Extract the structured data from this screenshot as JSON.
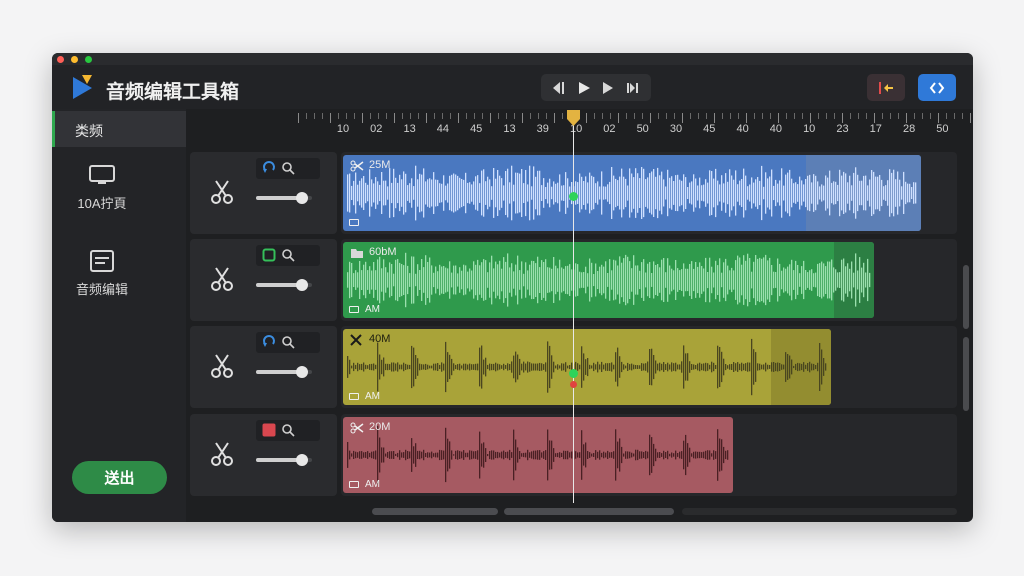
{
  "app": {
    "title": "音频编辑工具箱"
  },
  "header": {
    "transport": [
      {
        "name": "skip-back-icon"
      },
      {
        "name": "play-icon"
      },
      {
        "name": "step-forward-icon"
      },
      {
        "name": "skip-forward-icon"
      }
    ],
    "right_buttons": [
      {
        "name": "marker-icon",
        "color": "#3a3034"
      },
      {
        "name": "export-icon",
        "color": "#2f79d8"
      }
    ]
  },
  "sidebar": {
    "active_label": "类频",
    "items": [
      {
        "icon": "monitor-icon",
        "label": "10A拧頁"
      },
      {
        "icon": "document-icon",
        "label": "音频编辑"
      }
    ],
    "exit_label": "送出"
  },
  "ruler": {
    "labels": [
      "10",
      "02",
      "13",
      "44",
      "45",
      "13",
      "39",
      "10",
      "02",
      "50",
      "30",
      "45",
      "40",
      "40",
      "10",
      "23",
      "17",
      "28",
      "50"
    ]
  },
  "tracks": [
    {
      "size": "25M",
      "clip_icon": "scissors-icon",
      "sub": "",
      "color": "#4a78c0",
      "ext_color": "#5c7fb6",
      "btn1_color": "#3b8de0",
      "btn1_shape": "loop"
    },
    {
      "size": "60bM",
      "clip_icon": "folder-icon",
      "sub": "AM",
      "color": "#2f9a4c",
      "ext_color": "#2c7f43",
      "btn1_color": "#35c05a",
      "btn1_shape": "square"
    },
    {
      "size": "40M",
      "clip_icon": "close-icon",
      "sub": "AM",
      "color": "#a9a339",
      "ext_color": "#938d30",
      "btn1_color": "#3b8de0",
      "btn1_shape": "loop"
    },
    {
      "size": "20M",
      "clip_icon": "scissors-icon",
      "sub": "AM",
      "color": "#a65a62",
      "ext_color": "#a65a62",
      "btn1_color": "#d9474f",
      "btn1_shape": "filled"
    }
  ],
  "colors": {
    "accent_green": "#2e8b47",
    "playhead": "#e3b341"
  }
}
